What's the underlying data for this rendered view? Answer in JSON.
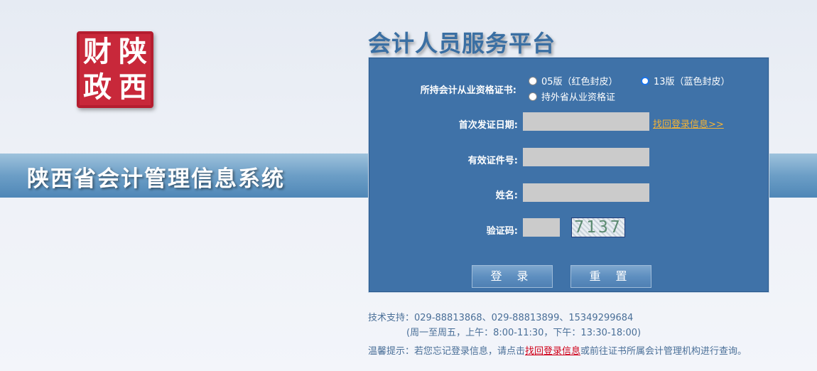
{
  "logo": {
    "chars": [
      "财",
      "陕",
      "政",
      "西"
    ]
  },
  "system_title": "陕西省会计管理信息系统",
  "platform_title": "会计人员服务平台",
  "form": {
    "cert_label": "所持会计从业资格证书:",
    "cert_options": [
      {
        "label": "05版（红色封皮）",
        "checked": false
      },
      {
        "label": "13版（蓝色封皮）",
        "checked": true
      },
      {
        "label": "持外省从业资格证",
        "checked": false
      }
    ],
    "issue_date_label": "首次发证日期:",
    "issue_date_value": "",
    "find_login_link": "找回登录信息>>",
    "id_label": "有效证件号:",
    "id_value": "",
    "name_label": "姓名:",
    "name_value": "",
    "captcha_label": "验证码:",
    "captcha_value": "",
    "captcha_image_text": "7137",
    "login_button": "登 录",
    "reset_button": "重 置"
  },
  "support": {
    "line1": "技术支持：029-88813868、029-88813899、15349299684",
    "line2": "(周一至周五，上午：8:00-11:30，下午：13:30-18:00)",
    "tip_prefix": "温馨提示：若您忘记登录信息，请点击",
    "tip_link": "找回登录信息",
    "tip_suffix": "或前往证书所属会计管理机构进行查询。"
  },
  "colors": {
    "panel_bg": "#3f72a8",
    "band_bg": "#6c9ec6",
    "link_orange": "#f5b335",
    "seal_red": "#c8283a"
  }
}
